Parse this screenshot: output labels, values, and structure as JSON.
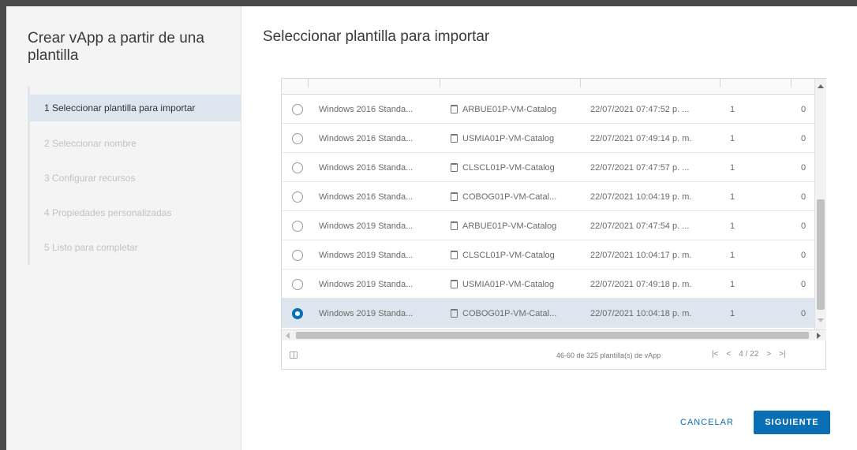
{
  "dialog": {
    "title": "Crear vApp a partir de una plantilla",
    "step_title": "Seleccionar plantilla para importar"
  },
  "steps": [
    {
      "label": "1  Seleccionar plantilla para importar",
      "active": true
    },
    {
      "label": "2  Seleccionar nombre",
      "active": false
    },
    {
      "label": "3  Configurar recursos",
      "active": false
    },
    {
      "label": "4  Propiedades personalizadas",
      "active": false
    },
    {
      "label": "5  Listo para completar",
      "active": false
    }
  ],
  "rows": [
    {
      "name": "Windows 2016 Standa...",
      "catalog": "ARBUE01P-VM-Catalog",
      "date": "22/07/2021 07:47:52 p. ...",
      "n1": "1",
      "n2": "0",
      "selected": false
    },
    {
      "name": "Windows 2016 Standa...",
      "catalog": "USMIA01P-VM-Catalog",
      "date": "22/07/2021 07:49:14 p. m.",
      "n1": "1",
      "n2": "0",
      "selected": false
    },
    {
      "name": "Windows 2016 Standa...",
      "catalog": "CLSCL01P-VM-Catalog",
      "date": "22/07/2021 07:47:57 p. ...",
      "n1": "1",
      "n2": "0",
      "selected": false
    },
    {
      "name": "Windows 2016 Standa...",
      "catalog": "COBOG01P-VM-Catal...",
      "date": "22/07/2021 10:04:19 p. m.",
      "n1": "1",
      "n2": "0",
      "selected": false
    },
    {
      "name": "Windows 2019 Standa...",
      "catalog": "ARBUE01P-VM-Catalog",
      "date": "22/07/2021 07:47:54 p. ...",
      "n1": "1",
      "n2": "0",
      "selected": false
    },
    {
      "name": "Windows 2019 Standa...",
      "catalog": "CLSCL01P-VM-Catalog",
      "date": "22/07/2021 10:04:17 p. m.",
      "n1": "1",
      "n2": "0",
      "selected": false
    },
    {
      "name": "Windows 2019 Standa...",
      "catalog": "USMIA01P-VM-Catalog",
      "date": "22/07/2021 07:49:18 p. m.",
      "n1": "1",
      "n2": "0",
      "selected": false
    },
    {
      "name": "Windows 2019 Standa...",
      "catalog": "COBOG01P-VM-Catal...",
      "date": "22/07/2021 10:04:18 p. m.",
      "n1": "1",
      "n2": "0",
      "selected": true
    }
  ],
  "footer": {
    "page_info": "46-60 de 325 plantilla(s) de vApp",
    "first": "|<",
    "prev": "<",
    "page": "4 / 22",
    "next": ">",
    "last": ">|"
  },
  "buttons": {
    "cancel": "CANCELAR",
    "next": "SIGUIENTE"
  },
  "colors": {
    "accent": "#0a6fb5",
    "selected_row": "#dde6ee"
  }
}
